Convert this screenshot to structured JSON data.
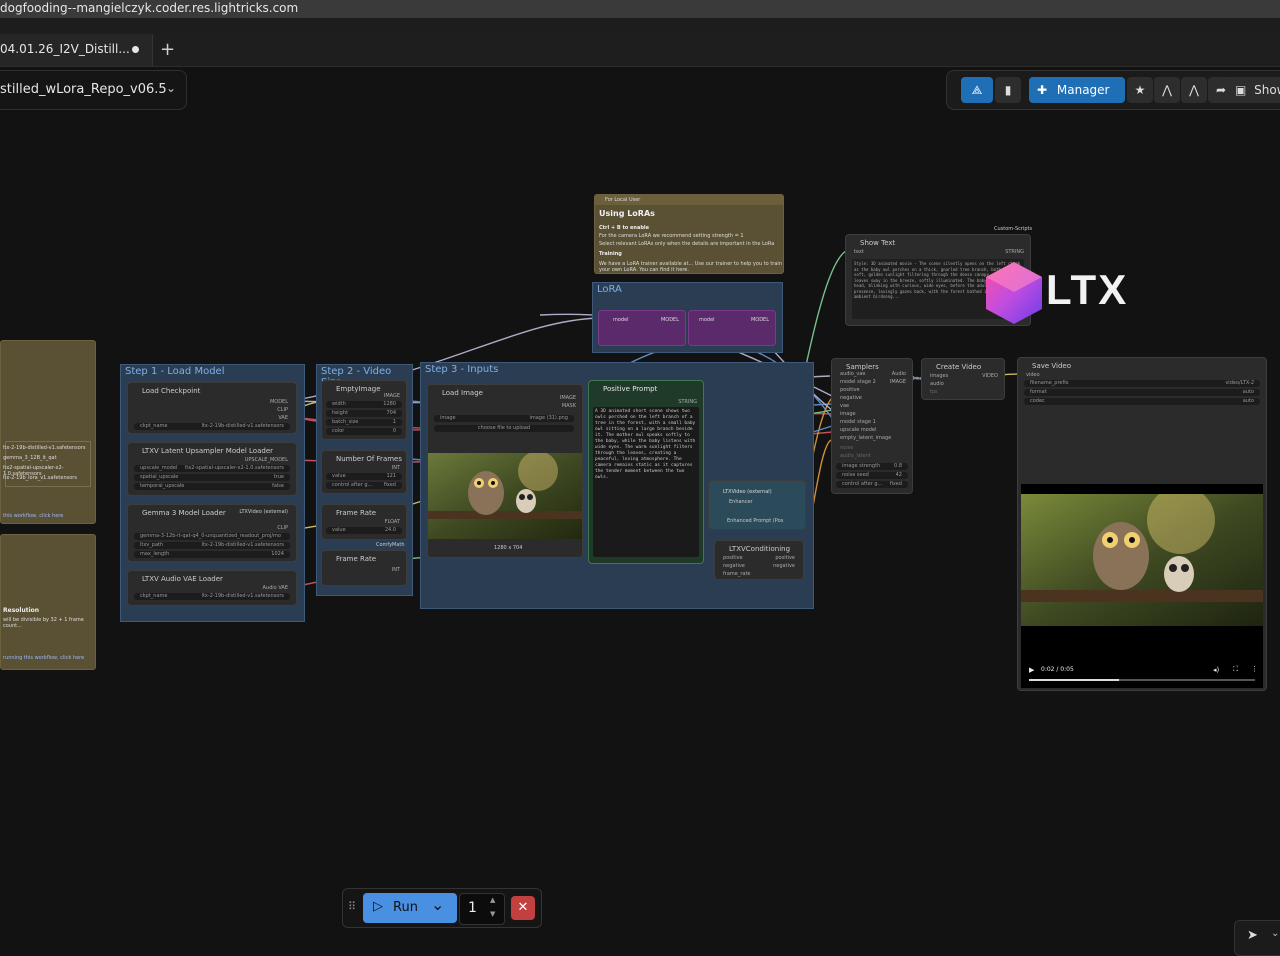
{
  "browser": {
    "url": "dogfooding--mangielczyk.coder.res.lightricks.com"
  },
  "tabs": [
    {
      "label": "04.01.26_I2V_Distill..."
    }
  ],
  "workflow": {
    "name": "stilled_wLora_Repo_v06.5"
  },
  "toolbar": {
    "manager_label": "Manager",
    "show_label": "Show"
  },
  "brand": {
    "logo_text": "LTX"
  },
  "groups": {
    "load_model": "Step 1 - Load Model",
    "video_size": "Step 2 - Video Size",
    "inputs": "Step 3 - Inputs",
    "lora": "LoRA"
  },
  "nodes": {
    "load_checkpoint": {
      "title": "Load Checkpoint",
      "ckpt_label": "ckpt_name",
      "ckpt_value": "ltx-2-19b-distilled-v1.safetensors",
      "out_model": "MODEL",
      "out_clip": "CLIP",
      "out_vae": "VAE"
    },
    "upsampler": {
      "title": "LTXV Latent Upsampler Model Loader",
      "out": "UPSCALE_MODEL",
      "f1_label": "upscale_model",
      "f1_value": "ltx2-spatial-upscaler-x2-1.0.safetensors",
      "f2_label": "spatial_upscale",
      "f2_value": "true",
      "f3_label": "temporal_upscale",
      "f3_value": "false"
    },
    "gemma": {
      "title": "Gemma 3 Model Loader",
      "badge": "LTXVideo (external)",
      "f1_value": "gemma-3-12b-it-qat-q4_0-unquantized_readout_proj/mo",
      "f2_label": "ltxv_path",
      "f2_value": "ltx-2-19b-distilled-v1.safetensors",
      "f3_label": "max_length",
      "f3_value": "1024",
      "out_clip": "CLIP"
    },
    "audio_vae": {
      "title": "LTXV Audio VAE Loader",
      "f1_label": "ckpt_name",
      "f1_value": "ltx-2-19b-distilled-v1.safetensors",
      "out": "Audio VAE"
    },
    "empty_image": {
      "title": "EmptyImage",
      "w_label": "width",
      "w_value": "1280",
      "h_label": "height",
      "h_value": "704",
      "b_label": "batch_size",
      "b_value": "1",
      "c_label": "color",
      "c_value": "0",
      "out": "IMAGE"
    },
    "num_frames": {
      "title": "Number Of Frames",
      "v_label": "value",
      "v_value": "121",
      "c_label": "control after g...",
      "c_value": "fixed",
      "out": "INT"
    },
    "frame_rate": {
      "title": "Frame Rate",
      "v_label": "value",
      "v_value": "24.0",
      "out": "FLOAT",
      "badge": "ComfyMath"
    },
    "frame_rate2": {
      "title": "Frame Rate",
      "out": "INT"
    },
    "load_image": {
      "title": "Load Image",
      "f_label": "image",
      "f_value": "image (31).png",
      "upload": "choose file to upload",
      "out_image": "IMAGE",
      "out_mask": "MASK",
      "caption": "1280 x 704"
    },
    "positive_prompt": {
      "title": "Positive Prompt",
      "out": "STRING",
      "text": "A 3D animated short scene shows two owls perched on the left branch of a tree in the forest, with a small baby owl sitting on a large branch beside it. The mother owl speaks softly to the baby, while the baby listens with wide eyes. The warm sunlight filters through the leaves, creating a peaceful, loving atmosphere. The camera remains static as it captures the tender moment between the two owls."
    },
    "enhancer": {
      "badge": "LTXVideo (external)",
      "title": "Enhancer",
      "sub": "Enhanced Prompt (Pos"
    },
    "conditioning": {
      "title": "LTXVConditioning",
      "in_pos": "positive",
      "in_neg": "negative",
      "in_fr": "frame_rate",
      "out_pos": "positive",
      "out_neg": "negative"
    },
    "lora_loader": {
      "in_model": "model",
      "out_model": "MODEL",
      "f_label": "model"
    },
    "show_text": {
      "title": "Show Text",
      "badge": "Custom-Scripts",
      "in": "text",
      "out": "STRING",
      "text": "Style: 3D animated movie - The scene silently opens on the left cheek as the baby owl perches on a thick, gnarled tree branch, bathed in soft, golden sunlight filtering through the dense canopy. Gentle leaves sway in the breeze, softly illuminated. The baby owl tilts its head, blinking with curious, wide eyes, before the adult owl, a wise presence, lovingly gazes back, with the forest bathed in sound and ambient birdsong..."
    },
    "sampler": {
      "title": "Samplers",
      "out_audio": "Audio",
      "out_image": "IMAGE",
      "inputs": [
        "audio_vae",
        "model stage 2",
        "positive",
        "negative",
        "vae",
        "image",
        "model stage 1",
        "upscale model",
        "empty_latent_image",
        "noise",
        "audio_latent"
      ],
      "f1_label": "image strength",
      "f1_value": "0.8",
      "f2_label": "noise seed",
      "f2_value": "42",
      "f3_label": "control after g...",
      "f3_value": "fixed"
    },
    "create_video": {
      "title": "Create Video",
      "in_images": "images",
      "in_audio": "audio",
      "in_fps": "fps",
      "out": "VIDEO"
    },
    "save_video": {
      "title": "Save Video",
      "in": "video",
      "f1_label": "filename_prefix",
      "f1_value": "video/LTX-2",
      "f2_label": "format",
      "f2_value": "auto",
      "f3_label": "codec",
      "f3_value": "auto",
      "time": "0:02 / 0:05"
    }
  },
  "notes": {
    "lora_note": {
      "header": "For Local User",
      "title": "Using LoRAs",
      "line1": "Ctrl + B to enable",
      "line2": "For the camera LoRA we recommend setting strength = 1",
      "line3": "Select relevant LoRAs only when the details are important in the LoRa",
      "sub": "Training",
      "line4": "We have a LoRA trainer available at... Use our trainer to help you to train your own LoRA. You can find it here."
    },
    "left_note1": {
      "lines": [
        "ltx-2-19b-distilled-v1.safetensors",
        "gemma_3_12B_it_qat",
        "ltx2-spatial-upscaler-x2-1.0.safetensors",
        "ltx-2-19b_lora_v1.safetensors"
      ],
      "link": "this workflow, click here"
    },
    "left_note2": {
      "title": "Resolution",
      "lines": [
        "will be divisible by 32 + 1 frame count..."
      ],
      "link": "running this workflow, click here"
    }
  },
  "run": {
    "label": "Run",
    "count": "1"
  }
}
